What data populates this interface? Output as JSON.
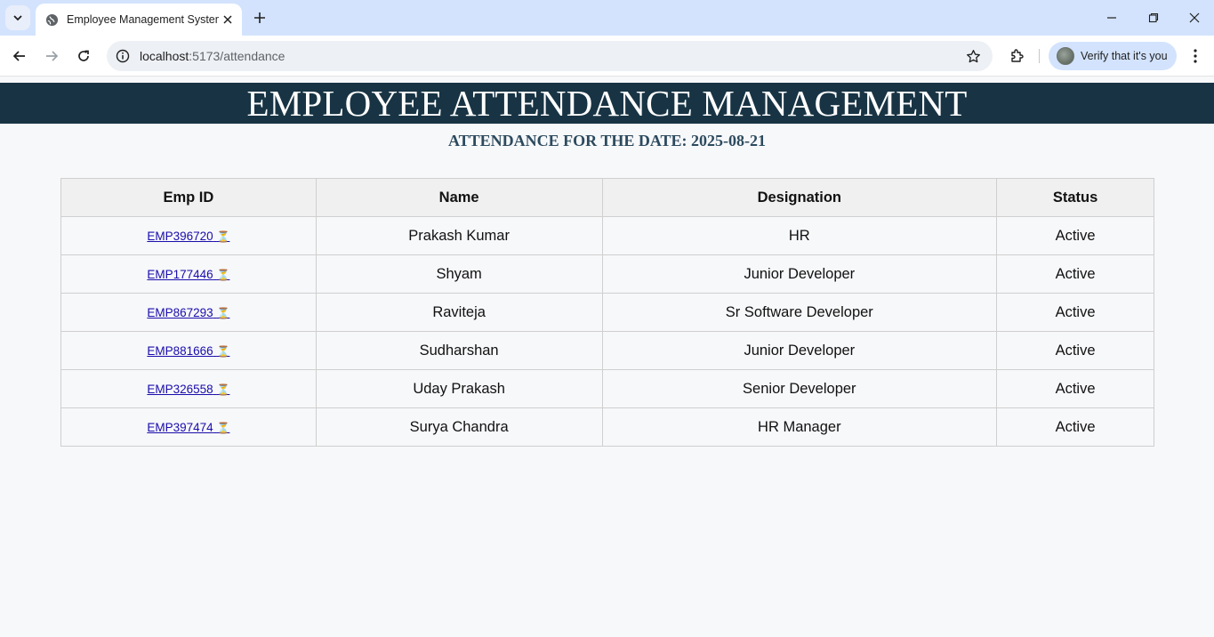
{
  "browser": {
    "tab_title": "Employee Management System",
    "url_host": "localhost",
    "url_path": ":5173/attendance",
    "profile_label": "Verify that it's you"
  },
  "page": {
    "header": "EMPLOYEE ATTENDANCE MANAGEMENT",
    "subtitle": "ATTENDANCE FOR THE DATE: 2025-08-21"
  },
  "table": {
    "columns": [
      "Emp ID",
      "Name",
      "Designation",
      "Status"
    ],
    "rows": [
      {
        "emp_id": "EMP396720",
        "name": "Prakash Kumar",
        "designation": "HR",
        "status": "Active"
      },
      {
        "emp_id": "EMP177446",
        "name": "Shyam",
        "designation": "Junior Developer",
        "status": "Active"
      },
      {
        "emp_id": "EMP867293",
        "name": "Raviteja",
        "designation": "Sr Software Developer",
        "status": "Active"
      },
      {
        "emp_id": "EMP881666",
        "name": "Sudharshan",
        "designation": "Junior Developer",
        "status": "Active"
      },
      {
        "emp_id": "EMP326558",
        "name": "Uday Prakash",
        "designation": "Senior Developer",
        "status": "Active"
      },
      {
        "emp_id": "EMP397474",
        "name": "Surya Chandra",
        "designation": "HR Manager",
        "status": "Active"
      }
    ],
    "link_icon": "hourglass-icon"
  },
  "colors": {
    "header_bg": "#183444",
    "subtitle": "#2c4a5e",
    "link": "#1a0dab",
    "tabbar_bg": "#d3e3fd"
  }
}
